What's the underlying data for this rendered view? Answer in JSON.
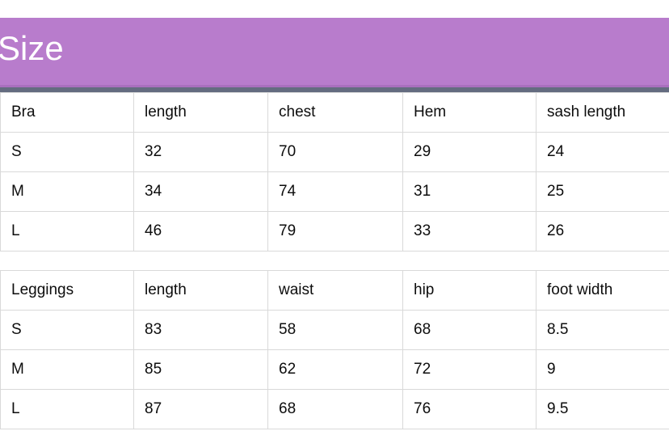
{
  "banner": {
    "title": "Size",
    "background_color": "#b87ccc",
    "title_color": "#ffffff",
    "rule_color": "#646c80"
  },
  "tables": [
    {
      "name": "bra-size-table",
      "headers": [
        "Bra",
        "length",
        "chest",
        "Hem",
        "sash length"
      ],
      "rows": [
        [
          "S",
          "32",
          "70",
          "29",
          "24"
        ],
        [
          "M",
          "34",
          "74",
          "31",
          "25"
        ],
        [
          "L",
          "46",
          "79",
          "33",
          "26"
        ]
      ]
    },
    {
      "name": "leggings-size-table",
      "headers": [
        "Leggings",
        "length",
        "waist",
        "hip",
        "foot width"
      ],
      "rows": [
        [
          "S",
          "83",
          "58",
          "68",
          "8.5"
        ],
        [
          "M",
          "85",
          "62",
          "72",
          "9"
        ],
        [
          "L",
          "87",
          "68",
          "76",
          "9.5"
        ]
      ]
    }
  ],
  "colors": {
    "border": "#d9d9d9",
    "text": "#0d0d0d",
    "page_background": "#ffffff"
  }
}
